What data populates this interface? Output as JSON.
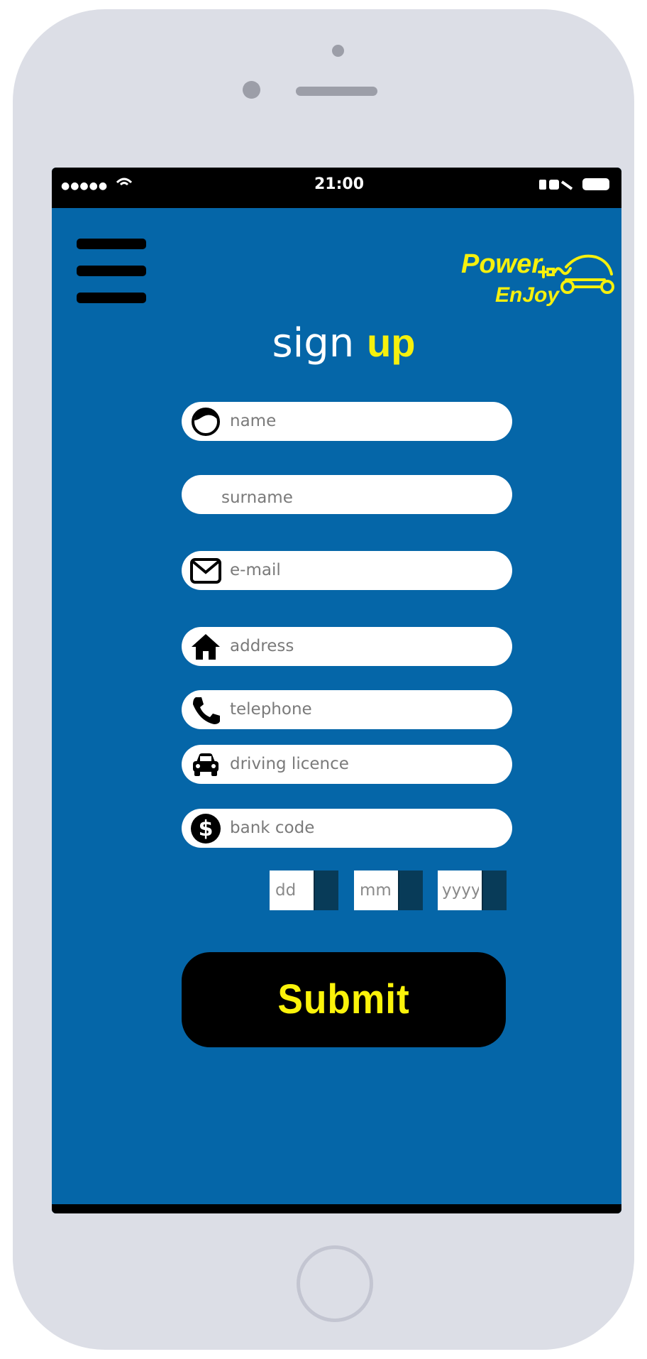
{
  "statusbar": {
    "signal": "●●●●●",
    "time": "21:00"
  },
  "header": {
    "menu_icon": "hamburger-menu-icon",
    "logo_line1": "Power",
    "logo_line2": "EnJoy",
    "logo_icon": "car-plug-icon"
  },
  "form": {
    "title_part1": "sign ",
    "title_part2": "up",
    "fields": {
      "name": {
        "placeholder": "name",
        "icon": "person-icon"
      },
      "surname": {
        "placeholder": "surname"
      },
      "email": {
        "placeholder": "e-mail",
        "icon": "envelope-icon"
      },
      "address": {
        "placeholder": "address",
        "icon": "home-icon"
      },
      "telephone": {
        "placeholder": "telephone",
        "icon": "phone-icon"
      },
      "driving_licence": {
        "placeholder": "driving licence",
        "icon": "car-icon"
      },
      "bank_code": {
        "placeholder": "bank code",
        "icon": "dollar-icon"
      }
    },
    "date": {
      "day_placeholder": "dd",
      "month_placeholder": "mm",
      "year_placeholder": "yyyy"
    },
    "submit_label": "Submit"
  },
  "colors": {
    "background": "#0566a8",
    "accent": "#f6f00d",
    "phone_body": "#dcdee6",
    "date_spinner": "#083b58"
  }
}
